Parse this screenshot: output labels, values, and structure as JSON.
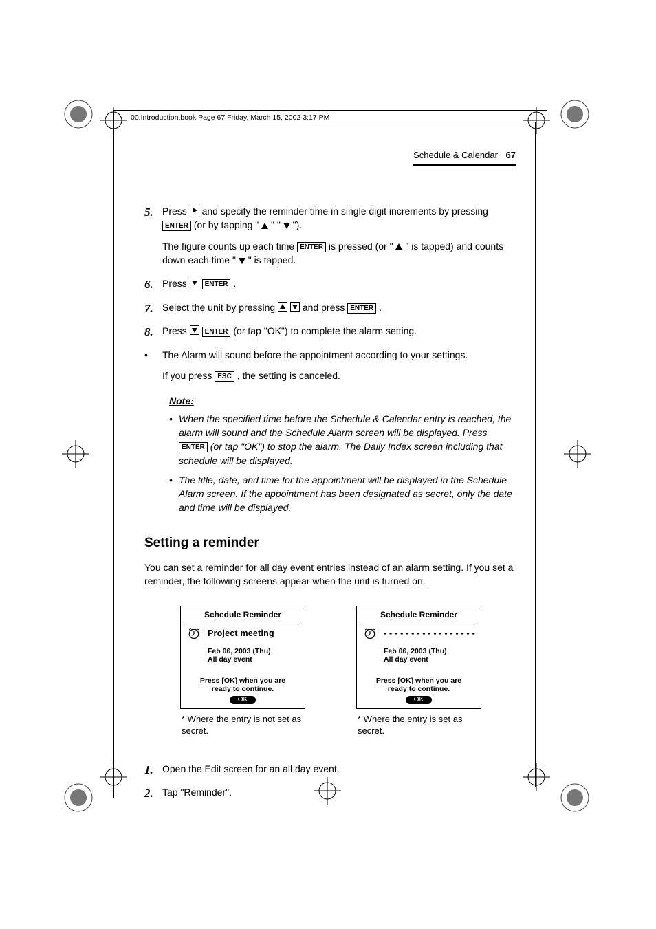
{
  "framemaker_header": "00.Introduction.book  Page 67  Friday, March 15, 2002  3:17 PM",
  "header": {
    "section": "Schedule & Calendar",
    "page": "67"
  },
  "keys": {
    "enter": "ENTER",
    "esc": "ESC"
  },
  "steps": {
    "s5_a": "Press ",
    "s5_b": " and specify the reminder time in single digit increments by pressing ",
    "s5_c": " (or by tapping \" ",
    "s5_d": " \" \" ",
    "s5_e": " \").",
    "s5_note_a": "The figure counts up each time ",
    "s5_note_b": " is pressed (or \" ",
    "s5_note_c": " \" is tapped) and counts down each time \" ",
    "s5_note_d": " \" is tapped.",
    "s6_a": "Press ",
    "s6_b": ".",
    "s7_a": "Select the unit by pressing ",
    "s7_b": " and press ",
    "s7_c": ".",
    "s8_a": "Press ",
    "s8_b": " (or tap \"OK\") to complete the alarm setting."
  },
  "bullets": {
    "b1": "The Alarm will sound before the appointment according to your settings.",
    "b1_sub_a": "If you press ",
    "b1_sub_b": ", the setting is canceled."
  },
  "note": {
    "heading": "Note:",
    "n1_a": "When the specified time before the Schedule & Calendar entry is reached, the alarm will sound and the Schedule Alarm screen will be displayed. Press ",
    "n1_b": " (or tap \"OK\") to stop the alarm. The Daily Index screen including that schedule will be displayed.",
    "n2": "The title, date, and time for the appointment will be displayed in the Schedule Alarm screen. If the appointment has been designated as secret, only the date and time will be displayed."
  },
  "section_heading": "Setting a reminder",
  "section_para": "You can set a reminder for all day event entries instead of an alarm setting. If you set a reminder, the following screens appear when the unit is turned on.",
  "screens": {
    "title": "Schedule Reminder",
    "entry_public": "Project meeting",
    "entry_secret": "- - - - - - - - - - - - - - - - -",
    "date": "Feb 06, 2003 (Thu)",
    "allday": "All day event",
    "msg1": "Press [OK] when you are",
    "msg2": "ready to continue.",
    "ok": "OK",
    "cap_left": "*  Where the entry is not set as secret.",
    "cap_right": "*  Where the entry is set as secret."
  },
  "steps2": {
    "s1": "Open the Edit screen for an all day event.",
    "s2": "Tap \"Reminder\"."
  }
}
